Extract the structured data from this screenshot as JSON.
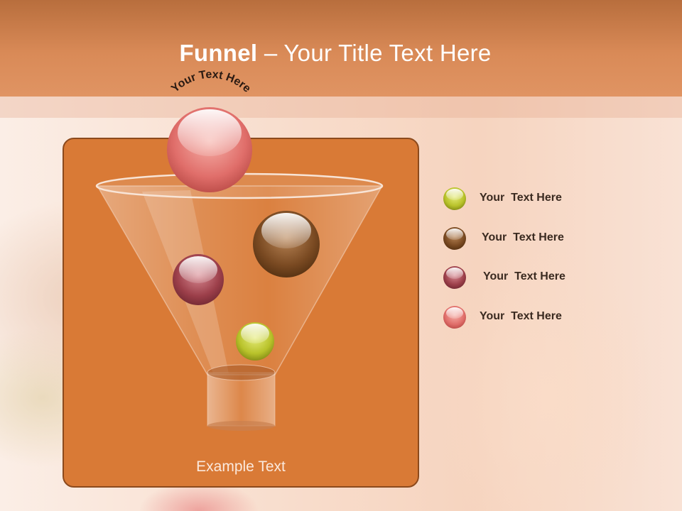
{
  "slide": {
    "title_bold": "Funnel",
    "title_rest": " – Your Title Text Here",
    "arc_label": "Your Text Here",
    "example_text": "Example Text"
  },
  "legend": [
    {
      "label": "Your  Text Here",
      "color": "#b8c22a"
    },
    {
      "label": "Your  Text Here",
      "color": "#7a4a22"
    },
    {
      "label": "Your  Text Here",
      "color": "#9c3f4a"
    },
    {
      "label": "Your  Text Here",
      "color": "#e06e6a"
    }
  ],
  "colors": {
    "header": "#d98a57",
    "panel": "#d97a36",
    "panel_border": "#8c4a1d",
    "ball_top": "#e06e6a",
    "ball_brown": "#7a4a22",
    "ball_maroon": "#9c3f4a",
    "ball_yellow": "#b8c22a"
  }
}
